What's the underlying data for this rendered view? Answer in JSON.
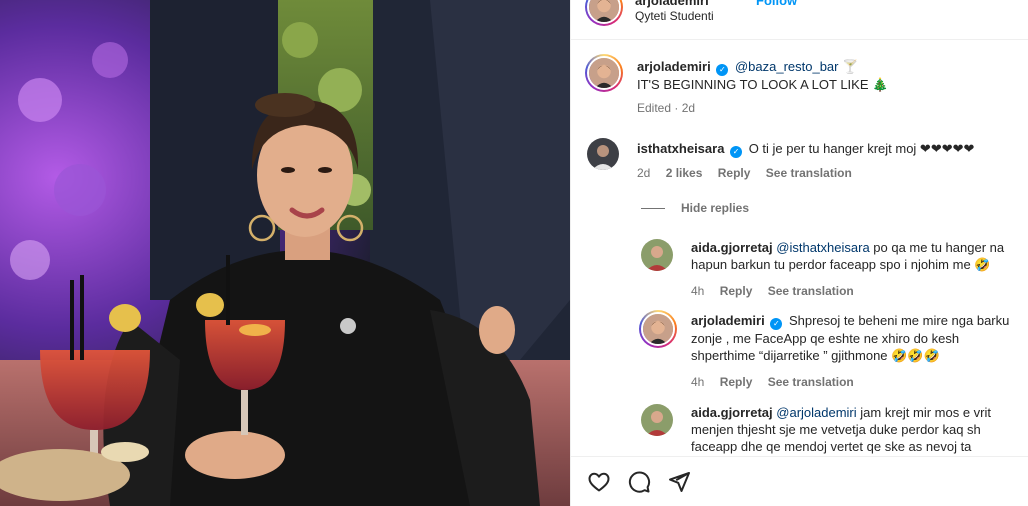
{
  "header": {
    "username": "arjolademiri",
    "follow_label": "Follow",
    "separator": "•",
    "location": "Qyteti Studenti"
  },
  "caption": {
    "username": "arjolademiri",
    "mention": "@baza_resto_bar",
    "mention_suffix": " 🍸",
    "text": "IT'S BEGINNING TO LOOK A LOT LIKE 🎄",
    "edited": "Edited · 2d"
  },
  "comments": [
    {
      "username": "isthatxheisara",
      "verified": true,
      "text": "O ti je per tu hanger krejt moj ❤❤❤❤❤",
      "time": "2d",
      "likes": "2 likes",
      "reply": "Reply",
      "translate": "See translation"
    }
  ],
  "hide_replies": "Hide replies",
  "replies": [
    {
      "username": "aida.gjorretaj",
      "mention": "@isthatxheisara",
      "text_line1": " po qa me tu hanger na",
      "text_line2": "hapun barkun tu perdor faceapp spo i njohim me 🤣",
      "time": "4h",
      "reply": "Reply",
      "translate": "See translation"
    },
    {
      "username": "arjolademiri",
      "verified": true,
      "text_line1": "Shpresoj te beheni me mire nga barku",
      "text_line2": "zonje , me FaceApp qe eshte ne xhiro do kesh",
      "text_line3": "shperthime “dijarretike ” gjithmone 🤣🤣🤣",
      "time": "4h",
      "reply": "Reply",
      "translate": "See translation"
    },
    {
      "username": "aida.gjorretaj",
      "mention": "@arjolademiri",
      "text_line1": " jam krejt mir mos e vrit",
      "text_line2": "menjen thjesht sje me vetvetja duke perdor kaq sh",
      "text_line3": "faceapp dhe qe mendoj vertet qe ske as nevoj ta"
    }
  ],
  "actions": {
    "like_icon": "heart-icon",
    "comment_icon": "comment-icon",
    "share_icon": "share-icon"
  },
  "colors": {
    "link_blue": "#0095f6",
    "mention_blue": "#00376b",
    "secondary_text": "#737373"
  }
}
